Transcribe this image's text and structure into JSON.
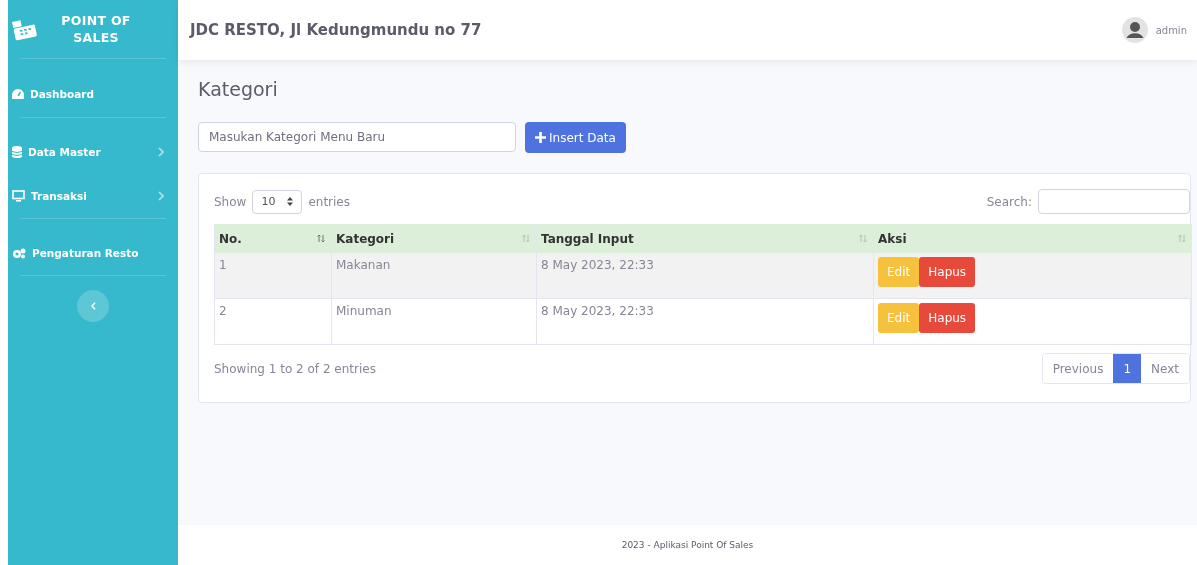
{
  "brand": {
    "title": "POINT OF SALES"
  },
  "sidebar": {
    "items": [
      {
        "label": "Dashboard",
        "has_submenu": false
      },
      {
        "label": "Data Master",
        "has_submenu": true
      },
      {
        "label": "Transaksi",
        "has_submenu": true
      },
      {
        "label": "Pengaturan Resto",
        "has_submenu": false
      }
    ]
  },
  "topbar": {
    "title": "JDC RESTO, Jl Kedungmundu no 77",
    "user": "admin"
  },
  "page_title": "Kategori",
  "new_category": {
    "placeholder": "Masukan Kategori Menu Baru",
    "button": "Insert Data"
  },
  "table": {
    "show_label": "Show",
    "page_size": "10",
    "entries_label": "entries",
    "search_label": "Search:",
    "columns": [
      "No.",
      "Kategori",
      "Tanggal Input",
      "Aksi"
    ],
    "rows": [
      {
        "no": "1",
        "kategori": "Makanan",
        "tanggal": "8 May 2023, 22:33",
        "actions": [
          "Edit",
          "Hapus"
        ]
      },
      {
        "no": "2",
        "kategori": "Minuman",
        "tanggal": "8 May 2023, 22:33",
        "actions": [
          "Edit",
          "Hapus"
        ]
      }
    ],
    "info": "Showing 1 to 2 of 2 entries",
    "pagination": [
      {
        "label": "Previous",
        "selected": false
      },
      {
        "label": "1",
        "selected": true
      },
      {
        "label": "Next",
        "selected": false
      }
    ]
  },
  "footer": "2023 - Aplikasi Point Of Sales"
}
